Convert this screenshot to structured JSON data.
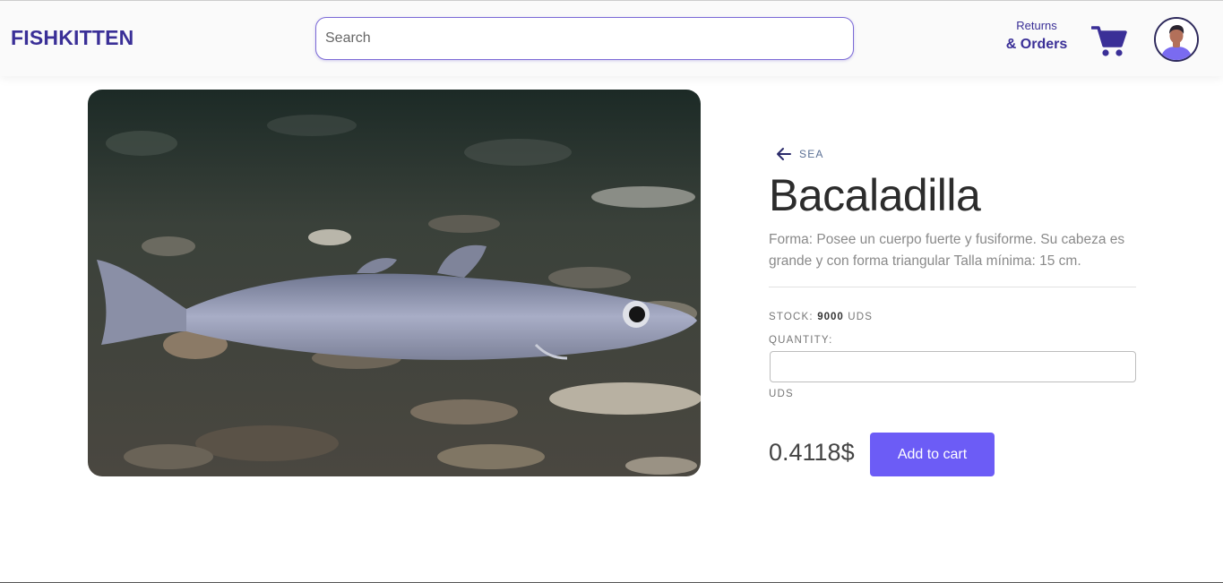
{
  "header": {
    "logo": "FISHKITTEN",
    "search_placeholder": "Search",
    "returns_line1": "Returns",
    "returns_line2": "& Orders",
    "cart_icon": "shopping-cart-icon",
    "avatar_icon": "user-avatar-icon"
  },
  "product": {
    "image_subject": "fish-photo",
    "back_label": "SEA",
    "back_icon": "arrow-left-icon",
    "name": "Bacaladilla",
    "description": "Forma: Posee un cuerpo fuerte y fusiforme. Su cabeza es grande y con forma triangular Talla mínima: 15 cm.",
    "stock_label": "STOCK:",
    "stock_value": "9000",
    "stock_units": "UDS",
    "quantity_label": "QUANTITY:",
    "quantity_value": "",
    "quantity_units": "UDS",
    "price": "0.4118$",
    "add_button": "Add to cart"
  },
  "colors": {
    "brand": "#3a2f97",
    "accent": "#6c5cf6",
    "search_border": "#7b6ad6"
  }
}
